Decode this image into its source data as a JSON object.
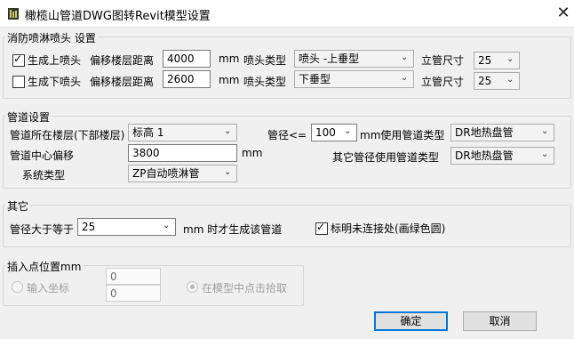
{
  "window": {
    "title": "橄榄山管道DWG图转Revit模型设置",
    "close_glyph": "✕"
  },
  "sprinkler": {
    "group_label": "消防喷淋喷头 设置",
    "rows": [
      {
        "checked": true,
        "label": "生成上喷头",
        "offset_label": "偏移楼层距离",
        "offset": "4000",
        "unit": "mm",
        "type_label": "喷头类型",
        "type": "喷头 -上垂型",
        "riser_label": "立管尺寸",
        "riser": "25"
      },
      {
        "checked": false,
        "label": "生成下喷头",
        "offset_label": "偏移楼层距离",
        "offset": "2600",
        "unit": "mm",
        "type_label": "喷头类型",
        "type": "下垂型",
        "riser_label": "立管尺寸",
        "riser": "25"
      }
    ]
  },
  "pipe": {
    "group_label": "管道设置",
    "level_label": "管道所在楼层(下部楼层)",
    "level": "标高 1",
    "center_offset_label": "管道中心偏移",
    "center_offset": "3800",
    "center_offset_unit": "mm",
    "system_type_label": "系统类型",
    "system_type": "ZP自动喷淋管",
    "diameter_label": "管径<=",
    "diameter": "100",
    "diameter_use_label": "mm使用管道类型",
    "diameter_pipe_type": "DR地热盘管",
    "other_label": "其它管径使用管道类型",
    "other_pipe_type": "DR地热盘管"
  },
  "other": {
    "group_label": "其它",
    "min_diameter_label": "管径大于等于",
    "min_diameter": "25",
    "min_diameter_suffix": "mm 时才生成该管道",
    "mark_unconnected_checked": true,
    "mark_unconnected_label": "标明未连接处(画绿色圆)"
  },
  "insert": {
    "group_label": "插入点位置mm",
    "input_coords_label": "输入坐标",
    "x": "0",
    "y": "0",
    "pick_label": "在模型中点击拾取"
  },
  "buttons": {
    "ok": "确定",
    "cancel": "取消"
  },
  "colors": {
    "accent": "#0078d7",
    "background": "#f0f0f0"
  }
}
